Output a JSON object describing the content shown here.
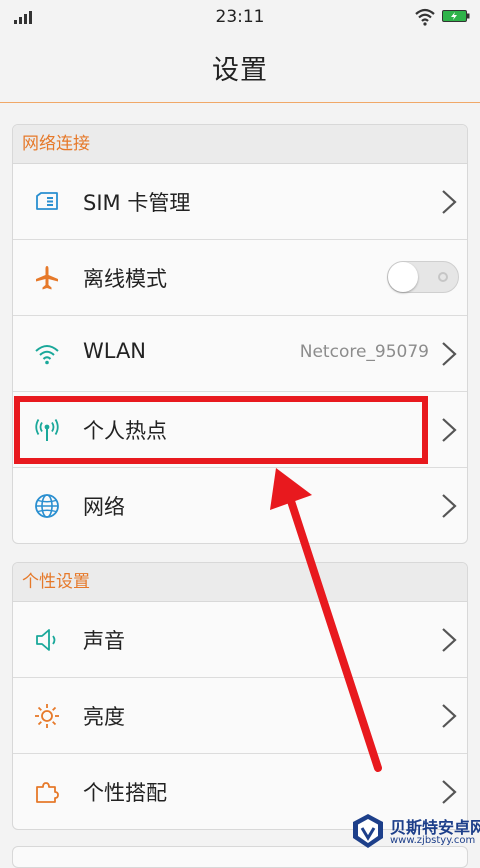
{
  "status_bar": {
    "time": "23:11"
  },
  "header": {
    "title": "设置"
  },
  "sections": [
    {
      "title": "网络连接",
      "items": [
        {
          "label": "SIM 卡管理",
          "icon": "sim-card-icon"
        },
        {
          "label": "离线模式",
          "icon": "airplane-icon",
          "toggle": "off"
        },
        {
          "label": "WLAN",
          "icon": "wifi-icon",
          "value": "Netcore_95079"
        },
        {
          "label": "个人热点",
          "icon": "hotspot-icon"
        },
        {
          "label": "网络",
          "icon": "globe-icon"
        }
      ]
    },
    {
      "title": "个性设置",
      "items": [
        {
          "label": "声音",
          "icon": "speaker-icon"
        },
        {
          "label": "亮度",
          "icon": "sun-icon"
        },
        {
          "label": "个性搭配",
          "icon": "puzzle-icon"
        }
      ]
    }
  ],
  "watermark": {
    "name": "贝斯特安卓网",
    "url": "www.zjbstyy.com"
  },
  "colors": {
    "accent": "#e6792a",
    "highlight": "#e8191e",
    "icon_orange": "#e6792a",
    "icon_teal": "#1aa89a",
    "icon_blue": "#2a8fd0"
  }
}
